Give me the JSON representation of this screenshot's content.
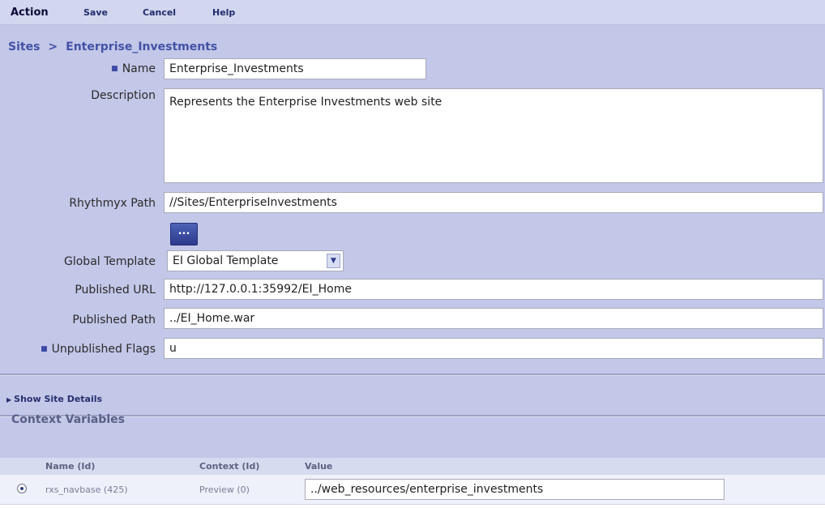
{
  "toolbar": {
    "title": "Action",
    "save": "Save",
    "cancel": "Cancel",
    "help": "Help"
  },
  "breadcrumb": {
    "root": "Sites",
    "separator": ">",
    "current": "Enterprise_Investments"
  },
  "form": {
    "name": {
      "label": "Name",
      "required": true,
      "value": "Enterprise_Investments"
    },
    "description": {
      "label": "Description",
      "value": "Represents the Enterprise Investments web site"
    },
    "rhythmyx_path": {
      "label": "Rhythmyx Path",
      "value": "//Sites/EnterpriseInvestments",
      "browse_label": "..."
    },
    "global_template": {
      "label": "Global Template",
      "selected": "EI Global Template"
    },
    "published_url": {
      "label": "Published URL",
      "value": "http://127.0.0.1:35992/EI_Home"
    },
    "published_path": {
      "label": "Published Path",
      "value": "../EI_Home.war"
    },
    "unpublished_flags": {
      "label": "Unpublished Flags",
      "required": true,
      "value": "u"
    }
  },
  "details_toggle": "Show Site Details",
  "context_variables": {
    "title": "Context Variables",
    "columns": [
      "Name (Id)",
      "Context (Id)",
      "Value"
    ],
    "rows": [
      {
        "name": "rxs_navbase (425)",
        "context": "Preview (0)",
        "value": "../web_resources/enterprise_investments"
      }
    ]
  },
  "colors": {
    "toolbar_bg": "#d2d6ee",
    "panel_bg": "#c3c7e8",
    "accent": "#4352a6",
    "button": "#2b3a8c"
  }
}
